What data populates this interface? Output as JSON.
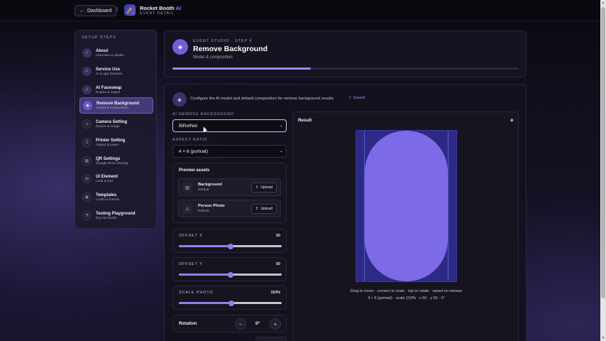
{
  "topbar": {
    "back_label": "Dashboard",
    "separator": "/",
    "brand_name": "Rocket Booth",
    "brand_ai": "AI",
    "brand_sub": "EVENT DETAIL",
    "logo_icon": "rocket-logo-icon"
  },
  "sidebar": {
    "title": "SETUP STEPS",
    "items": [
      {
        "label": "About",
        "sub": "Overview & details",
        "state": "done",
        "icon": "check-icon"
      },
      {
        "label": "Service Use",
        "sub": "AI & app features",
        "state": "done",
        "icon": "check-icon"
      },
      {
        "label": "AI Faceswap",
        "sub": "Engine & output",
        "state": "done",
        "icon": "check-icon"
      },
      {
        "label": "Remove Background",
        "sub": "Model & composition",
        "state": "active",
        "icon": "eraser-icon"
      },
      {
        "label": "Camera Setting",
        "sub": "Device & image",
        "state": "todo",
        "icon": "camera-icon"
      },
      {
        "label": "Printer Setting",
        "sub": "Output & paper",
        "state": "todo",
        "icon": "printer-icon"
      },
      {
        "label": "QR Settings",
        "sub": "Google Drive sharing",
        "state": "todo",
        "icon": "qr-icon"
      },
      {
        "label": "UI Element",
        "sub": "Look & feel",
        "state": "todo",
        "icon": "layout-icon"
      },
      {
        "label": "Templates",
        "sub": "Looks & frames",
        "state": "todo",
        "icon": "template-icon"
      },
      {
        "label": "Testing Playground",
        "sub": "Dry run booth",
        "state": "todo",
        "icon": "flask-icon"
      }
    ]
  },
  "header": {
    "kicker": "EVENT STUDIO · STEP 4",
    "title": "Remove Background",
    "subtitle": "Model & composition",
    "progress": 0.4
  },
  "main": {
    "description": "Configure the AI model and default composition for remove background results.",
    "saved_label": "Saved",
    "model_label": "AI REMOVE BACKGROUND",
    "model_value": "BiRefNet",
    "aspect_label": "ASPECT RATIO",
    "aspect_value": "4 × 6 (portrait)",
    "assets_title": "Preview assets",
    "assets": [
      {
        "name": "Background",
        "sub": "Default",
        "button": "Upload"
      },
      {
        "name": "Person Photo",
        "sub": "Default",
        "button": "Upload"
      }
    ],
    "sliders": [
      {
        "label": "OFFSET X",
        "value": "50",
        "fraction": 0.5
      },
      {
        "label": "OFFSET Y",
        "value": "50",
        "fraction": 0.5
      },
      {
        "label": "SCALE PHOTO",
        "value": "153%",
        "fraction": 0.51
      }
    ],
    "rotation_label": "Rotation",
    "rotation_value": "0°",
    "rotation_minus": "−",
    "rotation_plus": "+"
  },
  "result": {
    "title": "Result",
    "caption_line1": "Drag to move · corners to scale · top to rotate · saved on release",
    "caption_line2": "4 × 6 (portrait) · scale 153% · x 50 · y 50 · 0°"
  },
  "colors": {
    "accent": "#7c6ae6",
    "canvas_bg": "#2c2a85",
    "page_bg": "#0b0a10"
  }
}
